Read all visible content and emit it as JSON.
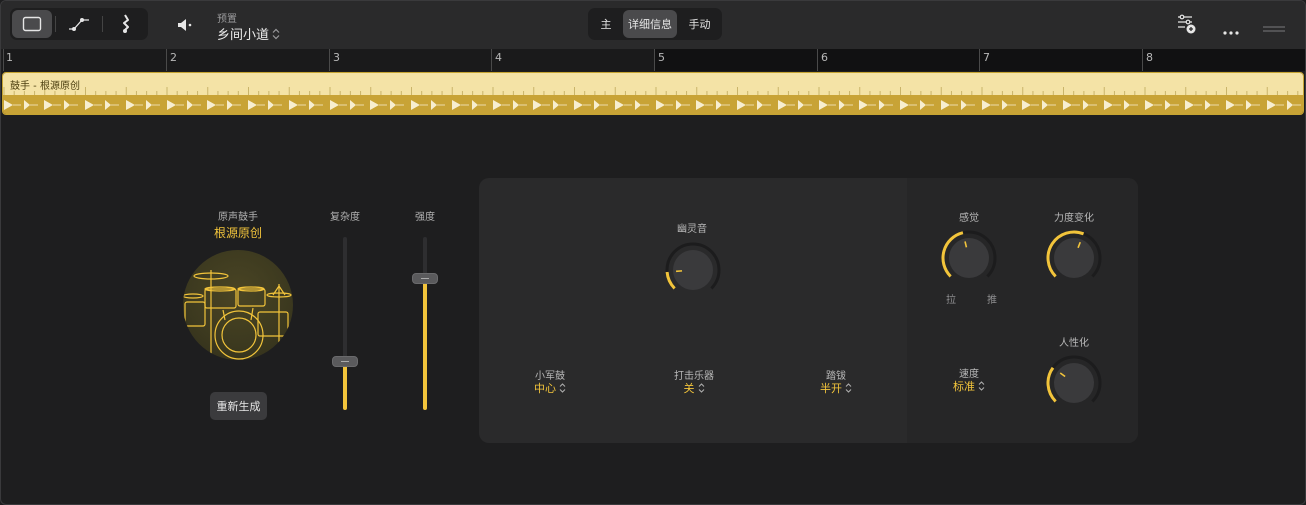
{
  "toolbar": {
    "view_buttons": [
      {
        "icon": "rectangle-view-icon",
        "active": true
      },
      {
        "icon": "automation-curve-icon",
        "active": false
      },
      {
        "icon": "score-notation-icon",
        "active": false
      }
    ],
    "mute_icon": "speaker-icon",
    "preset_label": "预置",
    "preset_value": "乡间小道",
    "tabs": [
      {
        "label": "主",
        "active": false
      },
      {
        "label": "详细信息",
        "active": true
      },
      {
        "label": "手动",
        "active": false
      }
    ],
    "right_icons": [
      "settings-sliders-icon",
      "more-icon",
      "drag-handle-icon"
    ]
  },
  "ruler": {
    "bars": [
      "1",
      "2",
      "3",
      "4",
      "5",
      "6",
      "7",
      "8"
    ]
  },
  "region": {
    "label": "鼓手 - 根源原创"
  },
  "drummer": {
    "label": "原声鼓手",
    "name": "根源原创",
    "regenerate_label": "重新生成"
  },
  "sliders": {
    "complexity": {
      "label": "复杂度",
      "value": 0.28
    },
    "loudness": {
      "label": "强度",
      "value": 0.76
    }
  },
  "ghost_notes": {
    "label": "幽灵音",
    "value": 0.15
  },
  "snare": {
    "label": "小军鼓",
    "value": "中心"
  },
  "percussion": {
    "label": "打击乐器",
    "value": "关"
  },
  "hihat": {
    "label": "踏钹",
    "value": "半开"
  },
  "feel": {
    "label": "感觉",
    "left": "拉",
    "right": "推",
    "value": 0.45
  },
  "velocity_variation": {
    "label": "力度变化",
    "value": 0.58
  },
  "speed": {
    "label": "速度",
    "value": "标准"
  },
  "humanize": {
    "label": "人性化",
    "value": 0.3
  },
  "colors": {
    "accent": "#f2c43b",
    "region_light": "#f4e3a6",
    "region_dark": "#c8a336",
    "background": "#1e1e1f",
    "panel": "#2a2a2b"
  }
}
